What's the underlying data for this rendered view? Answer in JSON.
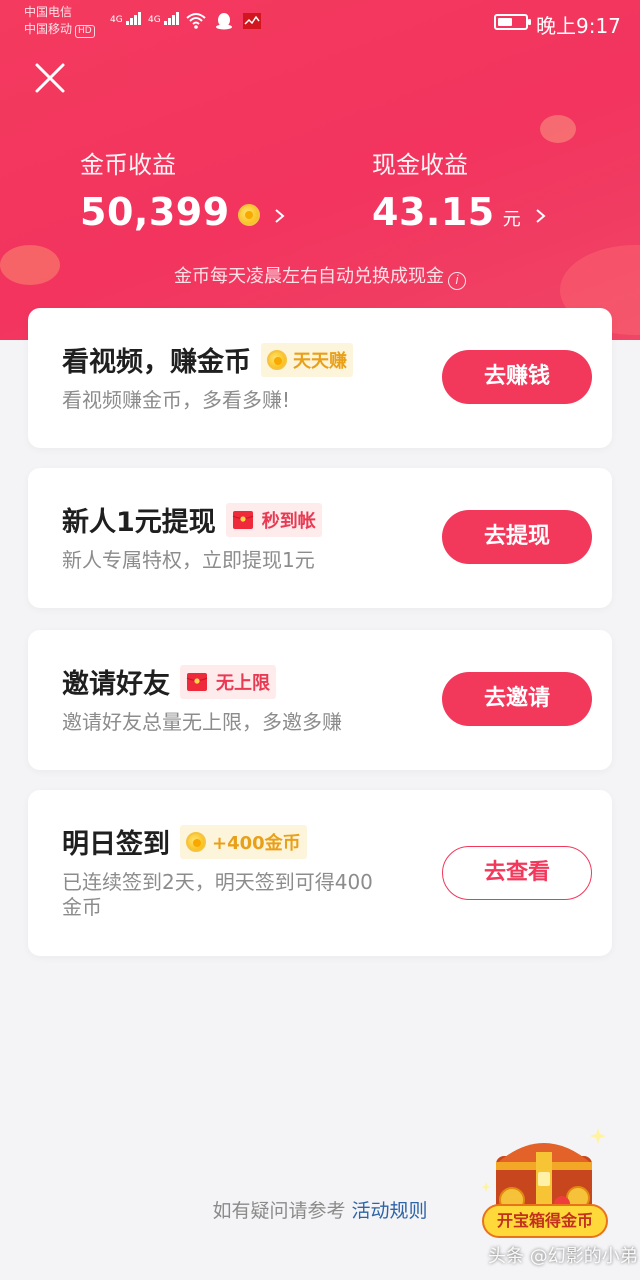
{
  "status_bar": {
    "carrier1": "中国电信",
    "carrier2": "中国移动",
    "hd": "HD",
    "net1": "4G",
    "net2": "4G",
    "time": "晚上9:17",
    "battery_level": 0.55
  },
  "earnings": {
    "coin_label": "金币收益",
    "coin_value": "50,399",
    "cash_label": "现金收益",
    "cash_value": "43.15",
    "cash_unit": "元",
    "exchange_note": "金币每天凌晨左右自动兑换成现金"
  },
  "tasks": [
    {
      "title": "看视频，赚金币",
      "tag": "天天赚",
      "tag_icon": "coin-icon",
      "desc": "看视频赚金币，多看多赚!",
      "button": "去赚钱",
      "button_style": "filled"
    },
    {
      "title": "新人1元提现",
      "tag": "秒到帐",
      "tag_icon": "redpacket-icon",
      "desc": "新人专属特权，立即提现1元",
      "button": "去提现",
      "button_style": "filled"
    },
    {
      "title": "邀请好友",
      "tag": "无上限",
      "tag_icon": "redpacket-icon",
      "desc": "邀请好友总量无上限，多邀多赚",
      "button": "去邀请",
      "button_style": "filled"
    },
    {
      "title": "明日签到",
      "tag": "+400金币",
      "tag_icon": "coin-icon",
      "desc_line1": "已连续签到2天，明天签到可得400",
      "desc_line2": "金币",
      "button": "去查看",
      "button_style": "outline"
    }
  ],
  "footer": {
    "question": "如有疑问请参考",
    "rules_link": "活动规则",
    "treasure_label": "开宝箱得金币",
    "watermark": "头条 @幻影的小弟"
  },
  "colors": {
    "accent": "#f2385b",
    "gold": "#e9a019",
    "link": "#2e64a8"
  }
}
